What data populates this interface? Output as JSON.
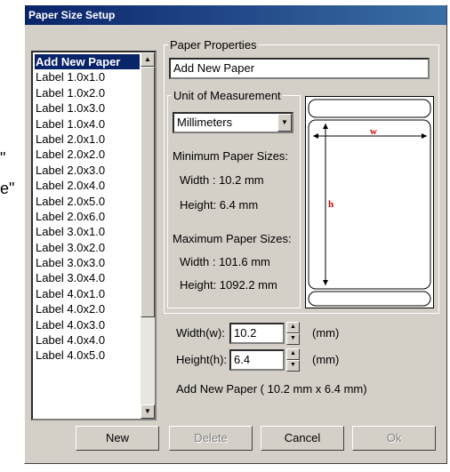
{
  "window": {
    "title": "Paper Size Setup"
  },
  "background_fragments": {
    "quote1": "\"",
    "quote2": "e\""
  },
  "paper_list": {
    "items": [
      "Add New Paper",
      "Label 1.0x1.0",
      "Label 1.0x2.0",
      "Label 1.0x3.0",
      "Label 1.0x4.0",
      "Label 2.0x1.0",
      "Label 2.0x2.0",
      "Label 2.0x3.0",
      "Label 2.0x4.0",
      "Label 2.0x5.0",
      "Label 2.0x6.0",
      "Label 3.0x1.0",
      "Label 3.0x2.0",
      "Label 3.0x3.0",
      "Label 3.0x4.0",
      "Label 4.0x1.0",
      "Label 4.0x2.0",
      "Label 4.0x3.0",
      "Label 4.0x4.0",
      "Label 4.0x5.0"
    ],
    "selected_index": 0
  },
  "paper_properties": {
    "legend": "Paper Properties",
    "name_value": "Add New Paper",
    "unit_legend": "Unit of Measurement",
    "unit_selected": "Millimeters",
    "min_title": "Minimum Paper Sizes:",
    "min_width": "Width : 10.2 mm",
    "min_height": "Height: 6.4 mm",
    "max_title": "Maximum Paper Sizes:",
    "max_width": "Width : 101.6 mm",
    "max_height": "Height: 1092.2 mm"
  },
  "preview": {
    "w_label": "w",
    "h_label": "h"
  },
  "size_inputs": {
    "width_label": "Width(w):",
    "width_value": "10.2",
    "height_label": "Height(h):",
    "height_value": "6.4",
    "unit_label": "(mm)",
    "summary": "Add New Paper ( 10.2 mm x 6.4 mm)"
  },
  "buttons": {
    "new": "New",
    "delete": "Delete",
    "cancel": "Cancel",
    "ok": "Ok"
  },
  "colors": {
    "title_bar": "#0a246a",
    "dialog_bg": "#d4d0c8",
    "selection": "#0a246a",
    "dimension_marks": "#cc0000"
  }
}
